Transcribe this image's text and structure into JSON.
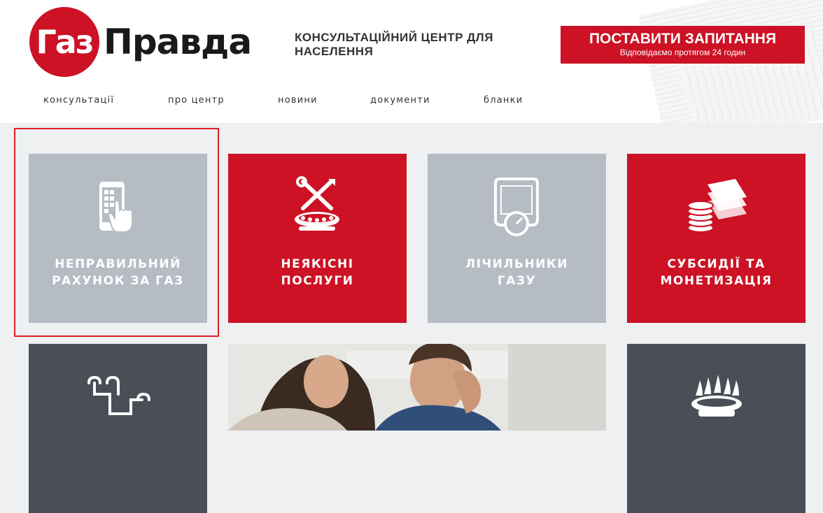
{
  "brand": {
    "logo_gaz": "Газ",
    "logo_pravda": "Правда"
  },
  "header": {
    "tagline": "КОНСУЛЬТАЦІЙНИЙ ЦЕНТР ДЛЯ НАСЕЛЕННЯ",
    "cta_title": "ПОСТАВИТИ ЗАПИТАННЯ",
    "cta_subtitle": "Відповідаємо протягом 24 годин"
  },
  "nav": [
    "консультації",
    "про центр",
    "новини",
    "документи",
    "бланки"
  ],
  "tiles": [
    {
      "label_line1": "НЕПРАВИЛЬНИЙ",
      "label_line2": "РАХУНОК ЗА ГАЗ",
      "icon": "phone-touch-icon",
      "highlighted": true
    },
    {
      "label_line1": "НЕЯКІСНІ",
      "label_line2": "ПОСЛУГИ",
      "icon": "tools-burner-icon"
    },
    {
      "label_line1": "ЛІЧИЛЬНИКИ",
      "label_line2": "ГАЗУ",
      "icon": "gas-meter-icon"
    },
    {
      "label_line1": "СУБСИДІЇ ТА",
      "label_line2": "МОНЕТИЗАЦІЯ",
      "icon": "coins-bills-icon"
    }
  ],
  "row2_tiles": [
    {
      "icon": "gas-pipes-icon"
    },
    {
      "icon": "couple-photo"
    },
    {
      "icon": "burner-flame-icon"
    }
  ],
  "colors": {
    "brand_red": "#cc1224",
    "tile_gray": "#b5bcc3",
    "tile_dark": "#4a4f57",
    "highlight": "#e21f26"
  }
}
